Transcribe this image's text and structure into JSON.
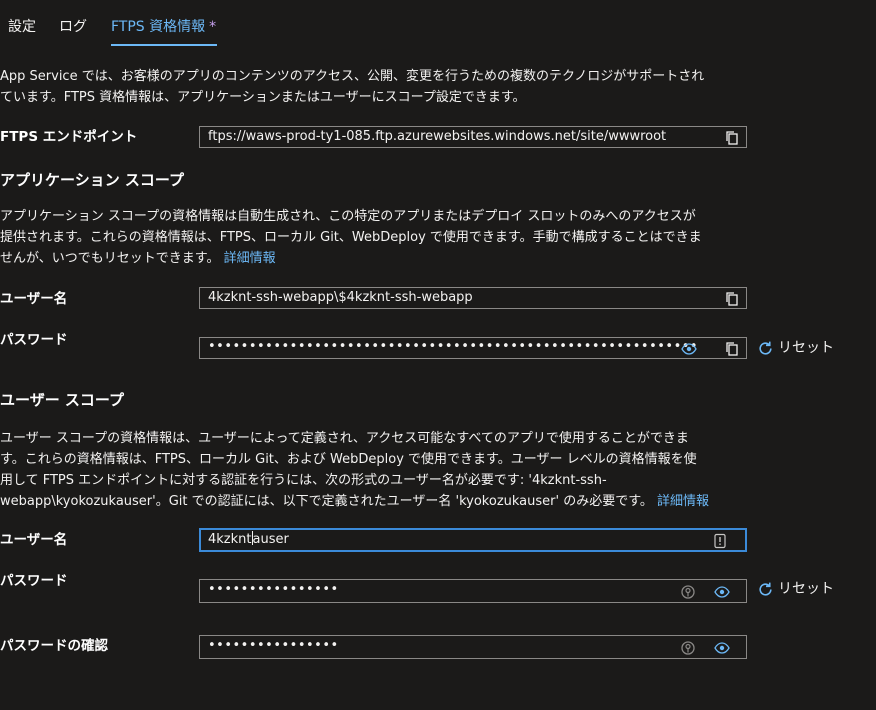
{
  "tabs": [
    {
      "label": "設定"
    },
    {
      "label": "ログ"
    },
    {
      "label": "FTPS 資格情報",
      "dirty_mark": "*"
    }
  ],
  "intro": {
    "line1": "App Service では、お客様のアプリのコンテンツのアクセス、公開、変更を行うための複数のテクノロジがサポートされ",
    "line2": "ています。FTPS 資格情報は、アプリケーションまたはユーザーにスコープ設定できます。"
  },
  "ftps": {
    "label": "FTPS エンドポイント",
    "value": "ftps://waws-prod-ty1-085.ftp.azurewebsites.windows.net/site/wwwroot"
  },
  "app_scope": {
    "heading": "アプリケーション スコープ",
    "desc_line1": "アプリケーション スコープの資格情報は自動生成され、この特定のアプリまたはデプロイ スロットのみへのアクセスが",
    "desc_line2": "提供されます。これらの資格情報は、FTPS、ローカル Git、WebDeploy で使用できます。手動で構成することはできま",
    "desc_line3": "せんが、いつでもリセットできます。",
    "more_info": "詳細情報",
    "username_label": "ユーザー名",
    "username_value": "4kzknt-ssh-webapp\\$4kzknt-ssh-webapp",
    "password_label": "パスワード",
    "password_value": "••••••••••••••••••••••••••••••••••••••••••••••••••••••••••••",
    "reset_label": "リセット"
  },
  "user_scope": {
    "heading": "ユーザー スコープ",
    "desc_line1": "ユーザー スコープの資格情報は、ユーザーによって定義され、アクセス可能なすべてのアプリで使用することができま",
    "desc_line2": "す。これらの資格情報は、FTPS、ローカル Git、および WebDeploy で使用できます。ユーザー レベルの資格情報を使",
    "desc_line3": "用して FTPS エンドポイントに対する認証を行うには、次の形式のユーザー名が必要です: '4kzknt-ssh-",
    "desc_line4": "webapp\\kyokozukauser'。Git での認証には、以下で定義されたユーザー名 'kyokozukauser' のみ必要です。",
    "more_info": "詳細情報",
    "username_label": "ユーザー名",
    "username_value_before_caret": "4kzknt",
    "username_value_after_caret": "auser",
    "password_label": "パスワード",
    "password_value": "••••••••••••••••",
    "reset_label": "リセット",
    "confirm_label": "パスワードの確認",
    "confirm_value": "••••••••••••••••"
  },
  "colors": {
    "accent": "#6cb8f6",
    "background": "#1b1a19",
    "focus_border": "#3b8ad8"
  }
}
